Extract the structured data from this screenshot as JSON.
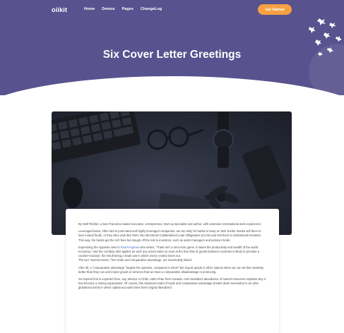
{
  "nav": {
    "logo": "oiikit",
    "items": [
      {
        "label": "Home"
      },
      {
        "label": "Demos"
      },
      {
        "label": "Pages"
      },
      {
        "label": "ChangeLog"
      }
    ],
    "cta_label": "Get Started"
  },
  "hero": {
    "title": "Six Cover Letter Greetings"
  },
  "colors": {
    "hero_bg": "#58528e",
    "cta": "#f5a142",
    "link": "#3f6fd8"
  },
  "article": {
    "p1": "By Wolf Richter, a San Francisco based executive, entrepreneur, start up specialist and author, with extensive international work experience.",
    "p2": "Leveraged loans, often tied to junk-rated and highly leveraged companies, are too risky for banks to keep on their books. Banks sell them to loan mutual funds, or they slice-and-dice them into structured Collateralized Loan Obligations (CLOs) and sell them to institutional investors. This way, the banks get the rich fees but slough off the risk to investors, such as asset managers and pension funds.",
    "p3_before": "Expressing the opposite view is ",
    "p3_link": "Paul Krugman",
    "p3_after": " who writes, \"Trade isn't a zero-sum game: it raises the productivity and wealth of the world economy,\" and the corollary also applies as well: any action taken to clam at the free flow of goods between countries is likely to provoke a counter-reaction: the result being a trade war in which every country loses out.",
    "p3_tail": "The two \"sacred tenets,\" free trade and comparative advantage, are inextricably linked.",
    "p4": "After all, a \"comparative advantage\" begets the question, compared to what? We export goods to other nations when we can do that relatively better than they can and import goods or services that we have a comparative disadvantage in producing.",
    "p5": "So tropical fruit is exported from, say, Mexico or Chile, rather than from Canada. And Australia's abundance of natural resources explains why it has become a mining superpower. Of course, this classical model of trade and comparative advantage breaks down somewhat in an ultra-globalized world in which capital accounts have been largely liberalized."
  }
}
